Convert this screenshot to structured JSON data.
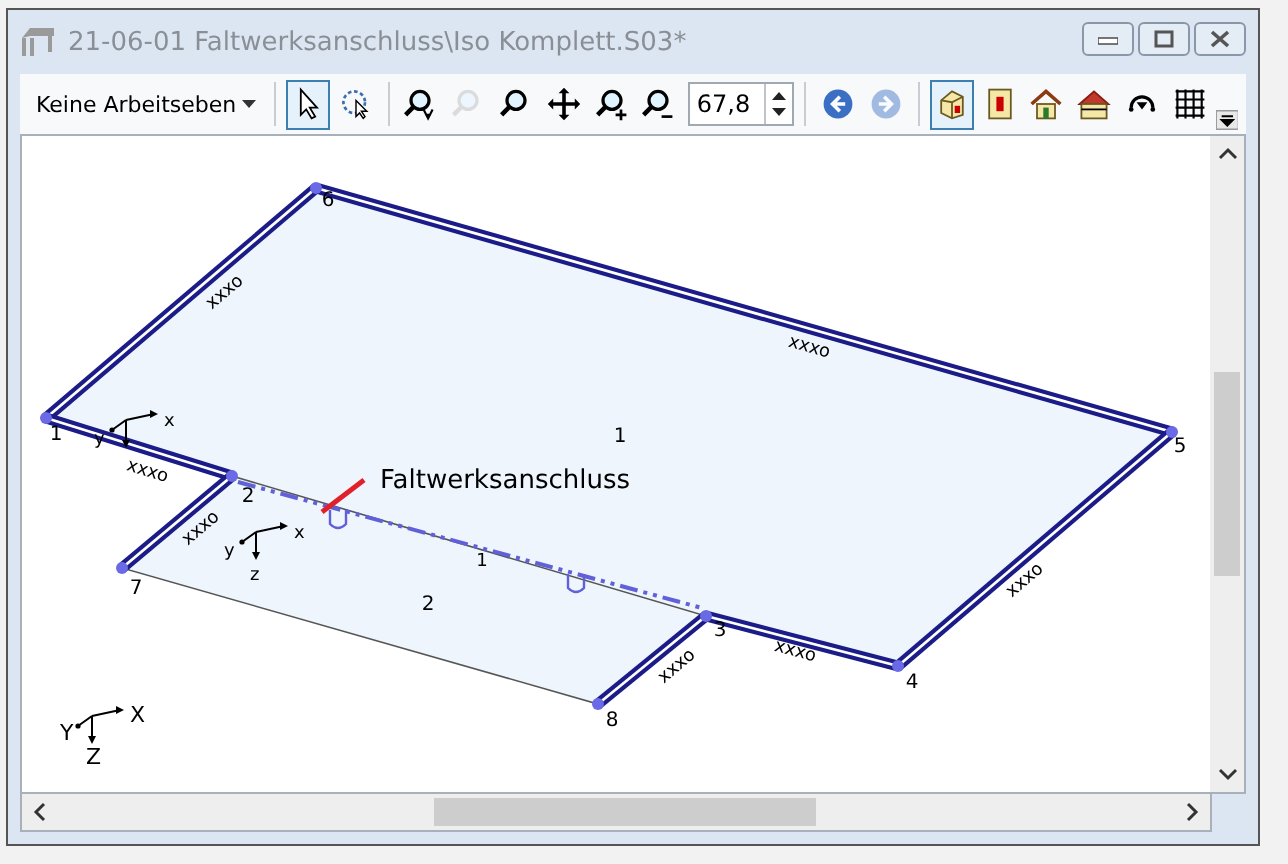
{
  "window": {
    "title": "21-06-01 Faltwerksanschluss\\Iso Komplett.S03*"
  },
  "toolbar": {
    "layer_dropdown": "Keine Arbeitseben",
    "groups": [
      [
        {
          "kind": "select",
          "selected": true,
          "disabled": false
        },
        {
          "kind": "rotate-select",
          "selected": false,
          "disabled": false
        }
      ],
      [
        {
          "kind": "zoom-all",
          "selected": false,
          "disabled": false
        },
        {
          "kind": "zoom",
          "selected": false,
          "disabled": true
        },
        {
          "kind": "zoom",
          "selected": false,
          "disabled": false
        },
        {
          "kind": "pan",
          "selected": false,
          "disabled": false
        },
        {
          "kind": "zoom-in",
          "selected": false,
          "disabled": false
        },
        {
          "kind": "zoom-out",
          "selected": false,
          "disabled": false
        },
        {
          "kind": "zoom-field",
          "value": "67,8"
        }
      ],
      [
        {
          "kind": "back",
          "selected": false,
          "disabled": false
        },
        {
          "kind": "forward",
          "selected": false,
          "disabled": true
        }
      ],
      [
        {
          "kind": "iso-view",
          "selected": true,
          "disabled": false
        },
        {
          "kind": "front-view",
          "selected": false,
          "disabled": false
        },
        {
          "kind": "house",
          "selected": false,
          "disabled": false
        },
        {
          "kind": "house-section",
          "selected": false,
          "disabled": false
        },
        {
          "kind": "rotate",
          "selected": false,
          "disabled": false
        },
        {
          "kind": "grid",
          "selected": false,
          "disabled": false
        }
      ]
    ]
  },
  "model": {
    "nodes": [
      "6",
      "1",
      "5",
      "4",
      "3",
      "2",
      "7",
      "8"
    ],
    "edge_labels": [
      "xxxo",
      "xxxo",
      "xxxo",
      "xxxo",
      "xxxo",
      "xxxo",
      "xxxo"
    ],
    "surfaces": [
      "1",
      "2"
    ],
    "line_label": "1",
    "annotation": "Faltwerksanschluss",
    "axes": [
      {
        "x": "x",
        "y": "y"
      },
      {
        "x": "x",
        "y": "y",
        "z": "z"
      },
      {
        "x": "X",
        "y": "Y",
        "z": "Z"
      }
    ]
  }
}
